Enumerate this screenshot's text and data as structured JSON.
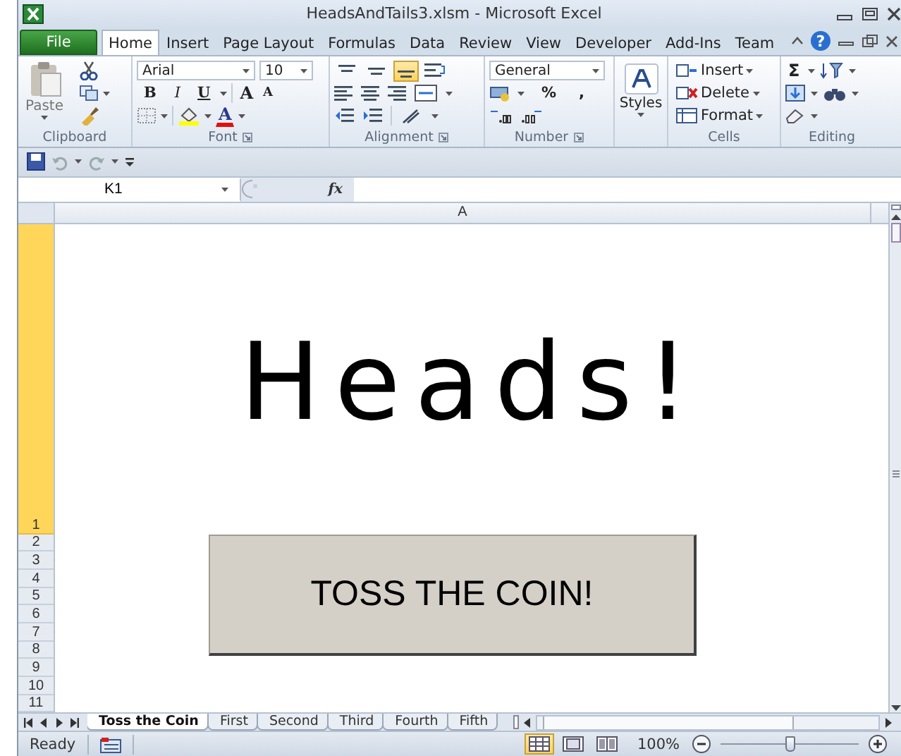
{
  "window": {
    "title": "HeadsAndTails3.xlsm - Microsoft Excel"
  },
  "ribbon_tabs": [
    {
      "label": "File",
      "kind": "file",
      "selected": false
    },
    {
      "label": "Home",
      "kind": "tab",
      "selected": true
    },
    {
      "label": "Insert",
      "kind": "tab",
      "selected": false
    },
    {
      "label": "Page Layout",
      "kind": "tab",
      "selected": false
    },
    {
      "label": "Formulas",
      "kind": "tab",
      "selected": false
    },
    {
      "label": "Data",
      "kind": "tab",
      "selected": false
    },
    {
      "label": "Review",
      "kind": "tab",
      "selected": false
    },
    {
      "label": "View",
      "kind": "tab",
      "selected": false
    },
    {
      "label": "Developer",
      "kind": "tab",
      "selected": false
    },
    {
      "label": "Add-Ins",
      "kind": "tab",
      "selected": false
    },
    {
      "label": "Team",
      "kind": "tab",
      "selected": false
    }
  ],
  "help": "?",
  "ribbon": {
    "clipboard": {
      "label": "Clipboard",
      "paste": "Paste"
    },
    "font": {
      "label": "Font",
      "name": "Arial",
      "size": "10",
      "bold": "B",
      "italic": "I",
      "underline": "U",
      "grow": "A",
      "shrink": "A",
      "color_letter": "A"
    },
    "alignment": {
      "label": "Alignment",
      "vertical": [
        {
          "kind": "top",
          "selected": false
        },
        {
          "kind": "middle",
          "selected": false
        },
        {
          "kind": "bottom",
          "selected": true
        }
      ]
    },
    "number": {
      "label": "Number",
      "format": "General",
      "percent": "%",
      "comma": ","
    },
    "styles": {
      "label": "Styles"
    },
    "cells": {
      "label": "Cells",
      "buttons": [
        "Insert",
        "Delete",
        "Format"
      ]
    },
    "editing": {
      "label": "Editing",
      "sum": "Σ"
    }
  },
  "name_box": "K1",
  "fx": "fx",
  "columns": [
    "A"
  ],
  "rows": [
    {
      "label": "1",
      "selected": true
    },
    {
      "label": "2",
      "selected": false
    },
    {
      "label": "3",
      "selected": false
    },
    {
      "label": "4",
      "selected": false
    },
    {
      "label": "5",
      "selected": false
    },
    {
      "label": "6",
      "selected": false
    },
    {
      "label": "7",
      "selected": false
    },
    {
      "label": "8",
      "selected": false
    },
    {
      "label": "9",
      "selected": false
    },
    {
      "label": "10",
      "selected": false
    },
    {
      "label": "11",
      "selected": false
    }
  ],
  "cell_text": "Heads!",
  "sheet_button": "TOSS THE COIN!",
  "sheet_tabs": [
    {
      "label": "Toss the Coin",
      "selected": true
    },
    {
      "label": "First",
      "selected": false
    },
    {
      "label": "Second",
      "selected": false
    },
    {
      "label": "Third",
      "selected": false
    },
    {
      "label": "Fourth",
      "selected": false
    },
    {
      "label": "Fifth",
      "selected": false
    }
  ],
  "status": {
    "text": "Ready",
    "views": [
      {
        "kind": "normal",
        "selected": true
      },
      {
        "kind": "page-layout",
        "selected": false
      },
      {
        "kind": "page-break",
        "selected": false
      }
    ],
    "zoom": "100%",
    "zoom_slider": {
      "level": 0.5
    }
  }
}
